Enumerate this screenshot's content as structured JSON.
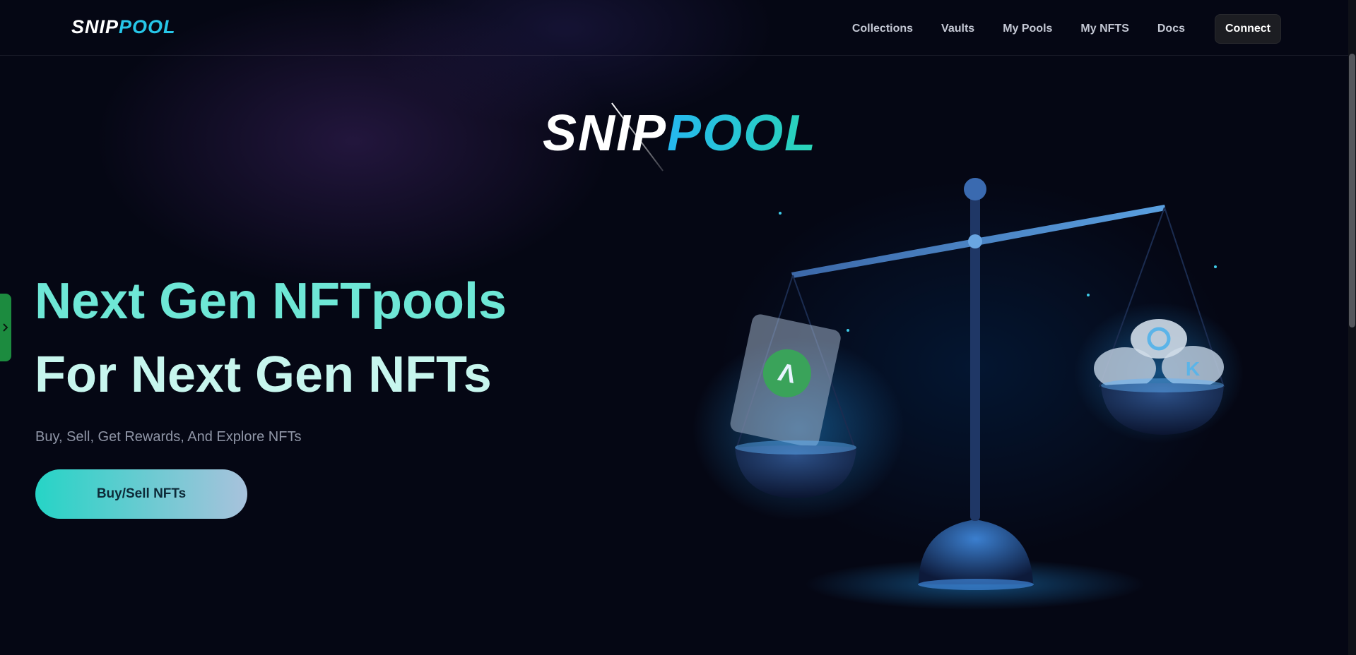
{
  "header": {
    "brand": {
      "part1": "SNIP",
      "part2": "POOL"
    },
    "nav": [
      "Collections",
      "Vaults",
      "My Pools",
      "My NFTS",
      "Docs"
    ],
    "connect_label": "Connect"
  },
  "hero": {
    "logo": {
      "part1": "SNIP",
      "part2": "POOL"
    },
    "headline_line1": "Next Gen NFTpools",
    "headline_line2": "For Next Gen NFTs",
    "subtitle": "Buy, Sell, Get Rewards, And Explore NFTs",
    "cta_label": "Buy/Sell NFTs",
    "coin_letters": [
      "Λ",
      "K"
    ]
  },
  "side_tab": {
    "icon": "chevron-right-icon"
  },
  "colors": {
    "background": "#050714",
    "accent_teal": "#6ee7d6",
    "accent_blue": "#26c6e8",
    "cta_gradient_start": "#26d4c6",
    "cta_gradient_end": "#a8c2dc",
    "side_tab": "#1c8b3f"
  }
}
